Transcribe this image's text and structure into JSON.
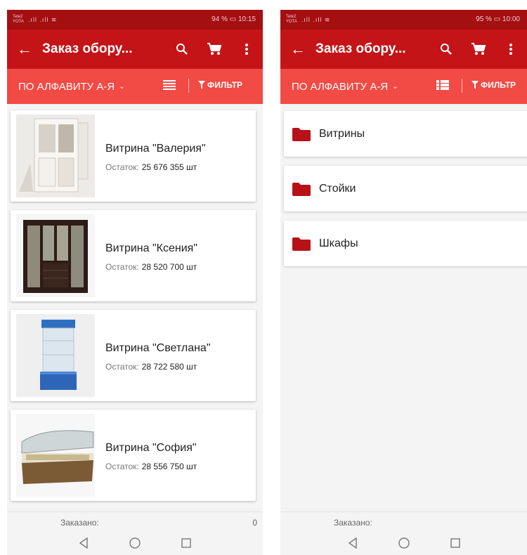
{
  "left": {
    "status": {
      "carrier_top": "Tele2",
      "carrier_bottom": "YOTA",
      "signal": ".ıll .ıll ≋",
      "battery": "94 %",
      "time": "10:15"
    },
    "appbar": {
      "title": "Заказ обору..."
    },
    "toolbar": {
      "sort_label": "ПО АЛФАВИТУ А-Я",
      "filter_label": "ФИЛЬТР"
    },
    "products": [
      {
        "name": "Витрина \"Валерия\"",
        "stock_label": "Остаток:",
        "stock_value": "25 676 355 шт",
        "image": "white-cabinet"
      },
      {
        "name": "Витрина \"Ксения\"",
        "stock_label": "Остаток:",
        "stock_value": "28 520 700 шт",
        "image": "dark-wardrobe"
      },
      {
        "name": "Витрина \"Светлана\"",
        "stock_label": "Остаток:",
        "stock_value": "28 722 580 шт",
        "image": "glass-showcase"
      },
      {
        "name": "Витрина \"София\"",
        "stock_label": "Остаток:",
        "stock_value": "28 556 750 шт",
        "image": "refrigerated-counter"
      }
    ],
    "footer": {
      "ordered_label": "Заказано:",
      "ordered_value": "0"
    }
  },
  "right": {
    "status": {
      "carrier_top": "Tele2",
      "carrier_bottom": "YOTA",
      "signal": ".ıll .ıll ≋",
      "battery": "95 %",
      "time": "10:00"
    },
    "appbar": {
      "title": "Заказ обору..."
    },
    "toolbar": {
      "sort_label": "ПО АЛФАВИТУ А-Я",
      "filter_label": "ФИЛЬТР"
    },
    "folders": [
      {
        "label": "Витрины"
      },
      {
        "label": "Стойки"
      },
      {
        "label": "Шкафы"
      }
    ],
    "footer": {
      "ordered_label": "Заказано:"
    }
  },
  "colors": {
    "status_bar": "#a40f12",
    "app_bar": "#c41418",
    "toolbar": "#f24a44",
    "folder": "#b71218"
  },
  "icons": [
    "back-arrow-icon",
    "search-icon",
    "cart-icon",
    "more-vert-icon",
    "chevron-down-icon",
    "list-view-icon",
    "grid-view-icon",
    "filter-icon",
    "folder-icon",
    "nav-back-icon",
    "nav-home-icon",
    "nav-recents-icon"
  ]
}
